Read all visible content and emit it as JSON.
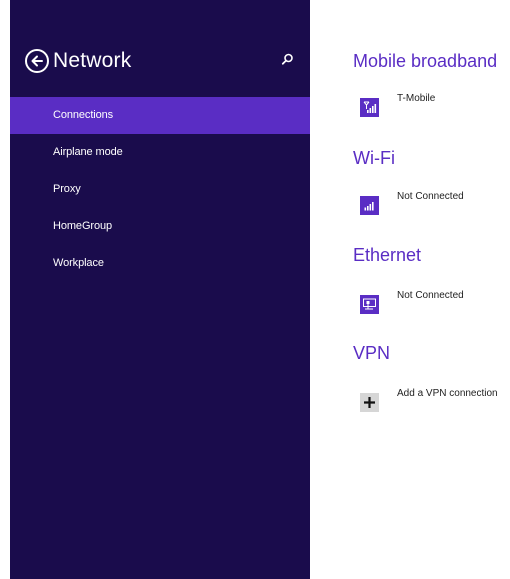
{
  "sidebar": {
    "title": "Network",
    "items": [
      {
        "label": "Connections",
        "active": true
      },
      {
        "label": "Airplane mode",
        "active": false
      },
      {
        "label": "Proxy",
        "active": false
      },
      {
        "label": "HomeGroup",
        "active": false
      },
      {
        "label": "Workplace",
        "active": false
      }
    ]
  },
  "main": {
    "sections": [
      {
        "title": "Mobile broadband",
        "entry": {
          "label": "T-Mobile",
          "icon": "cellular-signal-icon"
        }
      },
      {
        "title": "Wi-Fi",
        "entry": {
          "label": "Not Connected",
          "icon": "wifi-signal-icon"
        }
      },
      {
        "title": "Ethernet",
        "entry": {
          "label": "Not Connected",
          "icon": "ethernet-icon"
        }
      },
      {
        "title": "VPN",
        "entry": {
          "label": "Add a VPN connection",
          "icon": "plus-icon"
        }
      }
    ]
  },
  "colors": {
    "sidebar_bg": "#1a0c4c",
    "accent": "#5a2dc4",
    "add_tile": "#d6d6d6"
  }
}
